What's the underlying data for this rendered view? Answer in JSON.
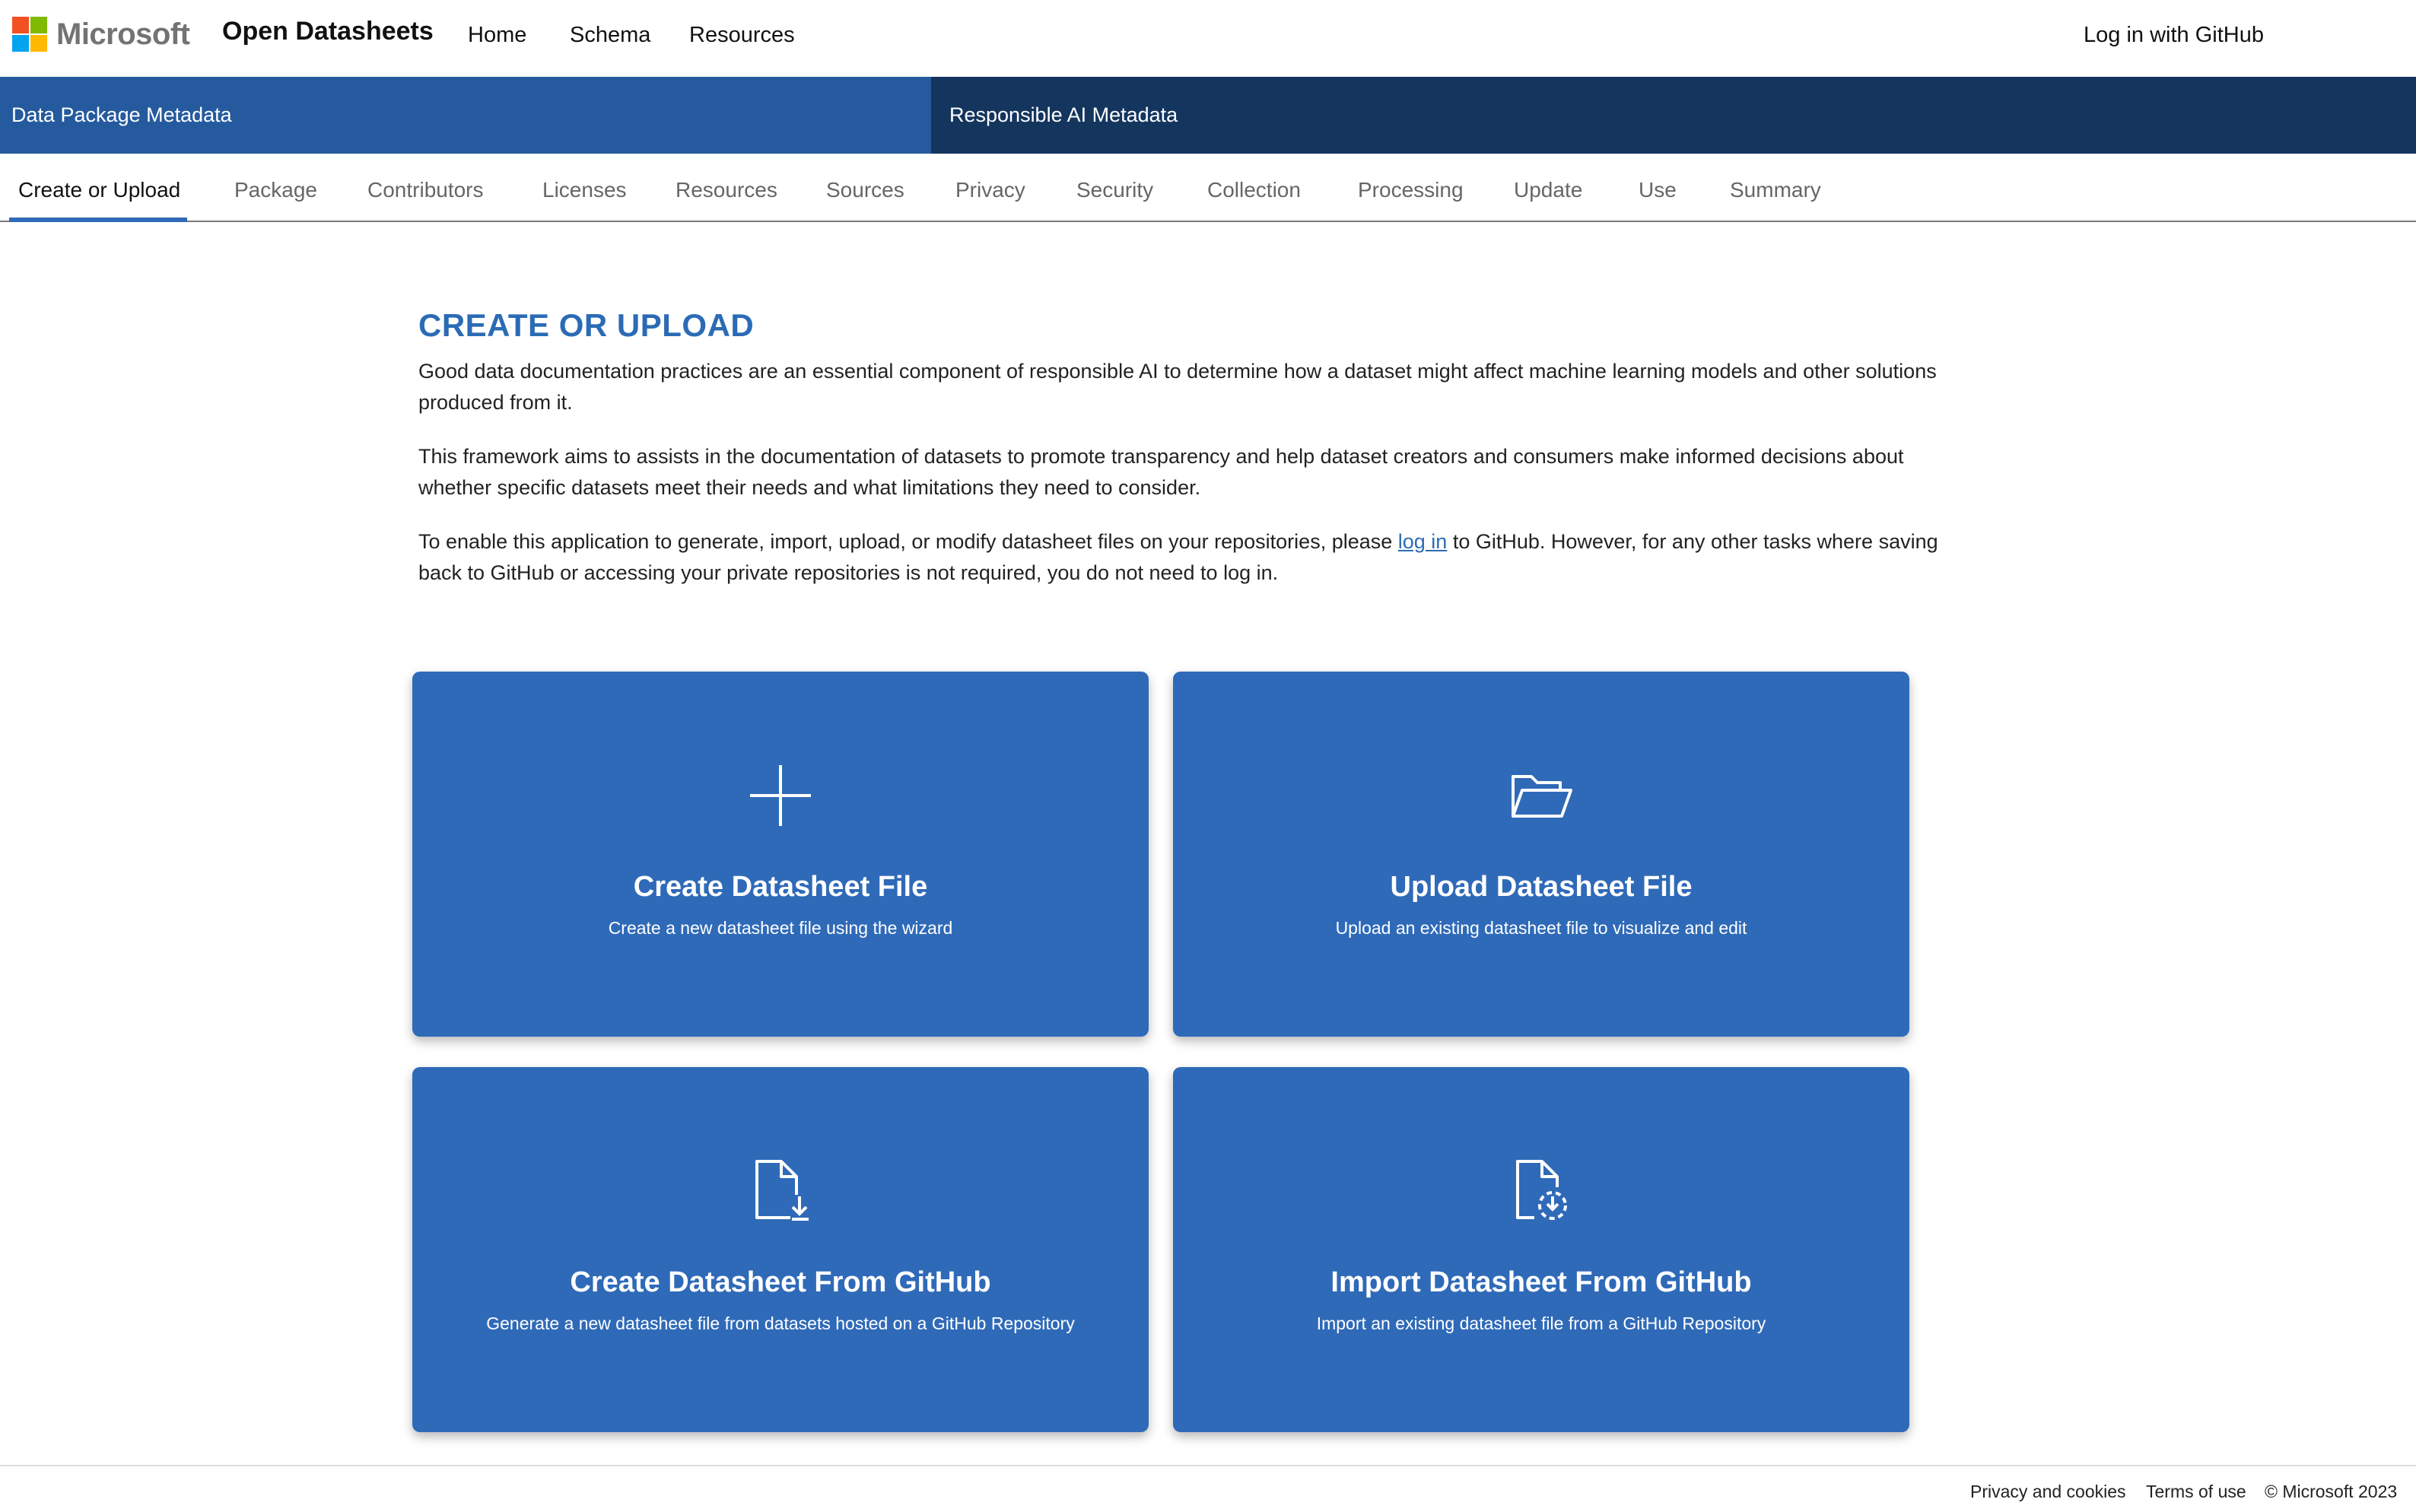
{
  "brand": {
    "logo_text": "Microsoft",
    "logo_colors": [
      "#f25022",
      "#7fba00",
      "#00a4ef",
      "#ffb900"
    ],
    "site_title": "Open Datasheets"
  },
  "nav": {
    "items": [
      "Home",
      "Schema",
      "Resources"
    ],
    "login": "Log in with GitHub"
  },
  "sections": {
    "left": "Data Package Metadata",
    "right": "Responsible AI Metadata"
  },
  "tabs": [
    {
      "label": "Create or Upload",
      "active": true
    },
    {
      "label": "Package",
      "active": false
    },
    {
      "label": "Contributors",
      "active": false
    },
    {
      "label": "Licenses",
      "active": false
    },
    {
      "label": "Resources",
      "active": false
    },
    {
      "label": "Sources",
      "active": false
    },
    {
      "label": "Privacy",
      "active": false
    },
    {
      "label": "Security",
      "active": false
    },
    {
      "label": "Collection",
      "active": false
    },
    {
      "label": "Processing",
      "active": false
    },
    {
      "label": "Update",
      "active": false
    },
    {
      "label": "Use",
      "active": false
    },
    {
      "label": "Summary",
      "active": false
    }
  ],
  "main": {
    "heading": "CREATE OR UPLOAD",
    "intro1": "Good data documentation practices are an essential component of responsible AI to determine how a dataset might affect machine learning models and other solutions produced from it.",
    "intro2": "This framework aims to assists in the documentation of datasets to promote transparency and help dataset creators and consumers make informed decisions about whether specific datasets meet their needs and what limitations they need to consider.",
    "intro3_before": "To enable this application to generate, import, upload, or modify datasheet files on your repositories, please ",
    "intro3_link": "log in",
    "intro3_after": " to GitHub. However, for any other tasks where saving back to GitHub or accessing your private repositories is not required, you do not need to log in."
  },
  "cards": [
    {
      "icon": "plus-icon",
      "title": "Create Datasheet File",
      "desc": "Create a new datasheet file using the wizard"
    },
    {
      "icon": "folder-open-icon",
      "title": "Upload Datasheet File",
      "desc": "Upload an existing datasheet file to visualize and edit"
    },
    {
      "icon": "document-download-icon",
      "title": "Create Datasheet From GitHub",
      "desc": "Generate a new datasheet file from datasets hosted on a GitHub Repository"
    },
    {
      "icon": "document-sync-icon",
      "title": "Import Datasheet From GitHub",
      "desc": "Import an existing datasheet file from a GitHub Repository"
    }
  ],
  "footer": {
    "privacy": "Privacy and cookies",
    "terms": "Terms of use",
    "copyright": "© Microsoft 2023"
  },
  "colors": {
    "card_blue": "#2f6ab8",
    "section_left": "#255a9e",
    "section_right": "#13355e",
    "heading_blue": "#2b6bb5"
  }
}
